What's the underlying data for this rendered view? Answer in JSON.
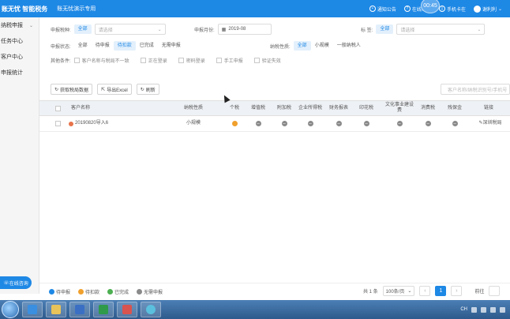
{
  "header": {
    "brand": "账无忧 智能税务",
    "account_label": "账无忧演示专用",
    "notice": "通知公告",
    "help": "在线帮助",
    "mobile": "手机卡在",
    "timer": "00:45",
    "user": "谢利利"
  },
  "sidebar": {
    "items": [
      {
        "label": "纳税申报",
        "chevron": "⌄"
      },
      {
        "label": "任务中心"
      },
      {
        "label": "客户中心"
      },
      {
        "label": "申报统计"
      }
    ],
    "online_button": "在线咨询"
  },
  "filters": {
    "row1": {
      "type_label": "申报税种:",
      "type_active": "全部",
      "type_placeholder": "请选择",
      "month_label": "申报月份:",
      "month_value": "2019-08",
      "tag_label": "标    签:",
      "tag_active": "全部",
      "tag_placeholder": "请选择"
    },
    "row2": {
      "status_label": "申报状态:",
      "status_options": [
        "全部",
        "待申报",
        "待扣款",
        "已完成",
        "无需申报"
      ],
      "status_active_index": 2,
      "taxpayer_label": "纳税性质:",
      "taxpayer_options": [
        "全部",
        "小规模",
        "一般纳税人"
      ],
      "taxpayer_active_index": 0
    },
    "row3": {
      "other_label": "其他条件:",
      "checks": [
        "客户名称与税局不一致",
        "正在登录",
        "密码登录",
        "手工申报",
        "验证失效"
      ]
    }
  },
  "toolbar": {
    "fetch": "获取税局数据",
    "export": "导出Excel",
    "refresh": "刷新",
    "search_placeholder": "客户名称/纳税识别号/手机号"
  },
  "table": {
    "headers": [
      "客户名称",
      "纳税性质",
      "个税",
      "增值税",
      "附加税",
      "企业所得税",
      "财务报表",
      "印花税",
      "文化事业建设费",
      "消费税",
      "残保金",
      "链接"
    ],
    "rows": [
      {
        "name": "20190820导入6",
        "taxpayer": "小规模",
        "statuses": [
          "pending",
          "none",
          "none",
          "none",
          "none",
          "none",
          "none",
          "none",
          "none"
        ],
        "link": "深圳税局"
      }
    ]
  },
  "legend": [
    {
      "label": "待申报",
      "color": "#1e88e5"
    },
    {
      "label": "待扣款",
      "color": "#f0a02c"
    },
    {
      "label": "已完成",
      "color": "#4caf50"
    },
    {
      "label": "无需申报",
      "color": "#8a8a8a"
    }
  ],
  "pager": {
    "total": "共 1 条",
    "page_size": "100条/页",
    "current": "1",
    "goto": "前往"
  },
  "taskbar": {
    "tray_text": "CH"
  }
}
